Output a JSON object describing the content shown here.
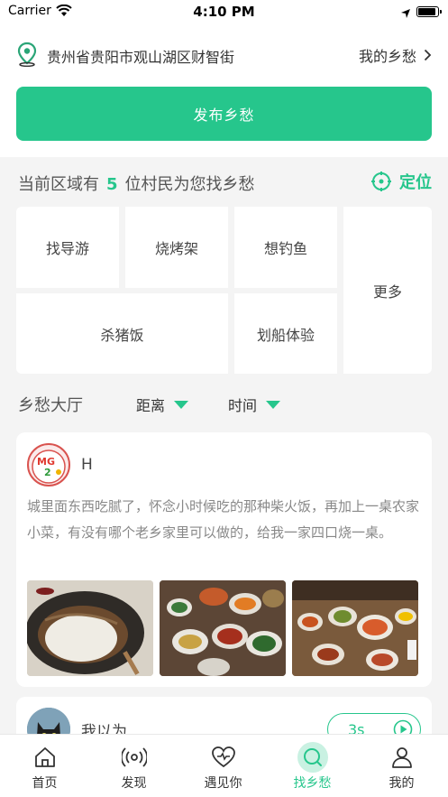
{
  "status_bar": {
    "carrier": "Carrier",
    "time": "4:10 PM"
  },
  "location": {
    "address": "贵州省贵阳市观山湖区财智街",
    "my_link": "我的乡愁"
  },
  "publish_button": "发布乡愁",
  "area": {
    "prefix": "当前区域有",
    "count": "5",
    "suffix": "位村民为您找乡愁",
    "locate_label": "定位"
  },
  "categories": [
    "找导游",
    "烧烤架",
    "想钓鱼",
    "更多",
    "杀猪饭",
    "划船体验"
  ],
  "hall": {
    "title": "乡愁大厅",
    "filter_distance": "距离",
    "filter_time": "时间"
  },
  "posts": [
    {
      "username": "H",
      "content": "城里面东西吃腻了，怀念小时候吃的那种柴火饭，再加上一桌农家小菜，有没有哪个老乡家里可以做的，给我一家四口烧一桌。",
      "photos": [
        "rice-pot",
        "dishes-table",
        "feast-table"
      ]
    },
    {
      "username": "我以为",
      "audio_duration": "3s"
    }
  ],
  "tab_bar": {
    "items": [
      {
        "label": "首页",
        "icon": "home-icon"
      },
      {
        "label": "发现",
        "icon": "radio-icon"
      },
      {
        "label": "遇见你",
        "icon": "heart-icon"
      },
      {
        "label": "找乡愁",
        "icon": "search-icon"
      },
      {
        "label": "我的",
        "icon": "user-icon"
      }
    ],
    "active_index": 3
  },
  "colors": {
    "accent": "#26c68c",
    "background": "#f4f4f4"
  }
}
